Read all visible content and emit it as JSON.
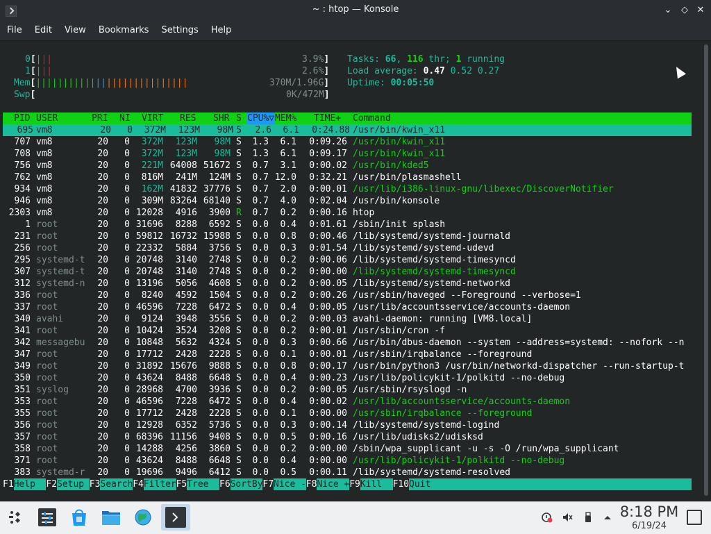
{
  "window": {
    "title": "~ : htop — Konsole",
    "controls": [
      "minimize-icon",
      "maximize-icon",
      "close-icon"
    ]
  },
  "menubar": [
    "File",
    "Edit",
    "View",
    "Bookmarks",
    "Settings",
    "Help"
  ],
  "meters": {
    "cpu0": {
      "label": "0",
      "value": "3.9%"
    },
    "cpu1": {
      "label": "1",
      "value": "2.6%"
    },
    "mem": {
      "label": "Mem",
      "value": "370M/1.96G"
    },
    "swp": {
      "label": "Swp",
      "value": "0K/472M"
    }
  },
  "stats": {
    "tasks_label": "Tasks: ",
    "tasks": "66",
    "thr": "116",
    "thr_label": " thr; ",
    "running": "1",
    "running_label": " running",
    "load_label": "Load average: ",
    "load1": "0.47",
    "load5": "0.52",
    "load15": "0.27",
    "uptime_label": "Uptime: ",
    "uptime": "00:05:50"
  },
  "columns": [
    "PID",
    "USER",
    "PRI",
    "NI",
    "VIRT",
    "RES",
    "SHR",
    "S",
    "CPU%▽",
    "MEM%",
    "TIME+",
    "Command"
  ],
  "processes": [
    {
      "pid": "695",
      "user": "vm8",
      "pri": "20",
      "ni": "0",
      "virt": "372M",
      "res": "123M",
      "shr": "98M",
      "s": "S",
      "cpu": "2.6",
      "mem": "6.1",
      "time": "0:24.88",
      "cmd": "/usr/bin/kwin_x11",
      "thread": false,
      "selected": true
    },
    {
      "pid": "707",
      "user": "vm8",
      "pri": "20",
      "ni": "0",
      "virt": "372M",
      "res": "123M",
      "shr": "98M",
      "s": "S",
      "cpu": "1.3",
      "mem": "6.1",
      "time": "0:09.26",
      "cmd": "/usr/bin/kwin_x11",
      "thread": true
    },
    {
      "pid": "708",
      "user": "vm8",
      "pri": "20",
      "ni": "0",
      "virt": "372M",
      "res": "123M",
      "shr": "98M",
      "s": "S",
      "cpu": "1.3",
      "mem": "6.1",
      "time": "0:09.17",
      "cmd": "/usr/bin/kwin_x11",
      "thread": true
    },
    {
      "pid": "756",
      "user": "vm8",
      "pri": "20",
      "ni": "0",
      "virt": "221M",
      "res": "64008",
      "shr": "51672",
      "s": "S",
      "cpu": "0.7",
      "mem": "3.1",
      "time": "0:00.02",
      "cmd": "/usr/bin/kded5",
      "thread": true
    },
    {
      "pid": "762",
      "user": "vm8",
      "pri": "20",
      "ni": "0",
      "virt": "816M",
      "res": "241M",
      "shr": "124M",
      "s": "S",
      "cpu": "0.7",
      "mem": "12.0",
      "time": "0:32.21",
      "cmd": "/usr/bin/plasmashell",
      "thread": false
    },
    {
      "pid": "934",
      "user": "vm8",
      "pri": "20",
      "ni": "0",
      "virt": "162M",
      "res": "41832",
      "shr": "37776",
      "s": "S",
      "cpu": "0.7",
      "mem": "2.0",
      "time": "0:00.01",
      "cmd": "/usr/lib/i386-linux-gnu/libexec/DiscoverNotifier",
      "thread": true
    },
    {
      "pid": "946",
      "user": "vm8",
      "pri": "20",
      "ni": "0",
      "virt": "309M",
      "res": "83264",
      "shr": "68140",
      "s": "S",
      "cpu": "0.7",
      "mem": "4.0",
      "time": "0:02.04",
      "cmd": "/usr/bin/konsole",
      "thread": false
    },
    {
      "pid": "2303",
      "user": "vm8",
      "pri": "20",
      "ni": "0",
      "virt": "12028",
      "res": "4916",
      "shr": "3900",
      "s": "R",
      "cpu": "0.7",
      "mem": "0.2",
      "time": "0:00.16",
      "cmd": "htop",
      "thread": false
    },
    {
      "pid": "1",
      "user": "root",
      "pri": "20",
      "ni": "0",
      "virt": "31696",
      "res": "8288",
      "shr": "6592",
      "s": "S",
      "cpu": "0.0",
      "mem": "0.4",
      "time": "0:01.61",
      "cmd": "/sbin/init splash",
      "thread": false
    },
    {
      "pid": "231",
      "user": "root",
      "pri": "20",
      "ni": "0",
      "virt": "59812",
      "res": "16732",
      "shr": "15988",
      "s": "S",
      "cpu": "0.0",
      "mem": "0.8",
      "time": "0:00.46",
      "cmd": "/lib/systemd/systemd-journald",
      "thread": false
    },
    {
      "pid": "256",
      "user": "root",
      "pri": "20",
      "ni": "0",
      "virt": "22332",
      "res": "5884",
      "shr": "3756",
      "s": "S",
      "cpu": "0.0",
      "mem": "0.3",
      "time": "0:01.54",
      "cmd": "/lib/systemd/systemd-udevd",
      "thread": false
    },
    {
      "pid": "295",
      "user": "systemd-t",
      "pri": "20",
      "ni": "0",
      "virt": "20748",
      "res": "3140",
      "shr": "2748",
      "s": "S",
      "cpu": "0.0",
      "mem": "0.2",
      "time": "0:00.06",
      "cmd": "/lib/systemd/systemd-timesyncd",
      "thread": false
    },
    {
      "pid": "307",
      "user": "systemd-t",
      "pri": "20",
      "ni": "0",
      "virt": "20748",
      "res": "3140",
      "shr": "2748",
      "s": "S",
      "cpu": "0.0",
      "mem": "0.2",
      "time": "0:00.00",
      "cmd": "/lib/systemd/systemd-timesyncd",
      "thread": true
    },
    {
      "pid": "312",
      "user": "systemd-n",
      "pri": "20",
      "ni": "0",
      "virt": "13196",
      "res": "5056",
      "shr": "4608",
      "s": "S",
      "cpu": "0.0",
      "mem": "0.2",
      "time": "0:00.05",
      "cmd": "/lib/systemd/systemd-networkd",
      "thread": false
    },
    {
      "pid": "336",
      "user": "root",
      "pri": "20",
      "ni": "0",
      "virt": "8240",
      "res": "4592",
      "shr": "1504",
      "s": "S",
      "cpu": "0.0",
      "mem": "0.2",
      "time": "0:00.26",
      "cmd": "/usr/sbin/haveged --Foreground --verbose=1",
      "thread": false
    },
    {
      "pid": "337",
      "user": "root",
      "pri": "20",
      "ni": "0",
      "virt": "46596",
      "res": "7228",
      "shr": "6472",
      "s": "S",
      "cpu": "0.0",
      "mem": "0.4",
      "time": "0:00.05",
      "cmd": "/usr/lib/accountsservice/accounts-daemon",
      "thread": false
    },
    {
      "pid": "340",
      "user": "avahi",
      "pri": "20",
      "ni": "0",
      "virt": "9124",
      "res": "3948",
      "shr": "3556",
      "s": "S",
      "cpu": "0.0",
      "mem": "0.2",
      "time": "0:00.03",
      "cmd": "avahi-daemon: running [VM8.local]",
      "thread": false
    },
    {
      "pid": "341",
      "user": "root",
      "pri": "20",
      "ni": "0",
      "virt": "10424",
      "res": "3524",
      "shr": "3208",
      "s": "S",
      "cpu": "0.0",
      "mem": "0.2",
      "time": "0:00.01",
      "cmd": "/usr/sbin/cron -f",
      "thread": false
    },
    {
      "pid": "342",
      "user": "messagebu",
      "pri": "20",
      "ni": "0",
      "virt": "10848",
      "res": "5632",
      "shr": "4324",
      "s": "S",
      "cpu": "0.0",
      "mem": "0.3",
      "time": "0:00.66",
      "cmd": "/usr/bin/dbus-daemon --system --address=systemd: --nofork --n",
      "thread": false
    },
    {
      "pid": "347",
      "user": "root",
      "pri": "20",
      "ni": "0",
      "virt": "17712",
      "res": "2428",
      "shr": "2228",
      "s": "S",
      "cpu": "0.0",
      "mem": "0.1",
      "time": "0:00.01",
      "cmd": "/usr/sbin/irqbalance --foreground",
      "thread": false
    },
    {
      "pid": "349",
      "user": "root",
      "pri": "20",
      "ni": "0",
      "virt": "31892",
      "res": "15676",
      "shr": "9888",
      "s": "S",
      "cpu": "0.0",
      "mem": "0.8",
      "time": "0:00.17",
      "cmd": "/usr/bin/python3 /usr/bin/networkd-dispatcher --run-startup-t",
      "thread": false
    },
    {
      "pid": "350",
      "user": "root",
      "pri": "20",
      "ni": "0",
      "virt": "43624",
      "res": "8488",
      "shr": "6648",
      "s": "S",
      "cpu": "0.0",
      "mem": "0.4",
      "time": "0:00.23",
      "cmd": "/usr/lib/policykit-1/polkitd --no-debug",
      "thread": false
    },
    {
      "pid": "351",
      "user": "syslog",
      "pri": "20",
      "ni": "0",
      "virt": "28968",
      "res": "4700",
      "shr": "3936",
      "s": "S",
      "cpu": "0.0",
      "mem": "0.2",
      "time": "0:00.05",
      "cmd": "/usr/sbin/rsyslogd -n",
      "thread": false
    },
    {
      "pid": "353",
      "user": "root",
      "pri": "20",
      "ni": "0",
      "virt": "46596",
      "res": "7228",
      "shr": "6472",
      "s": "S",
      "cpu": "0.0",
      "mem": "0.4",
      "time": "0:00.02",
      "cmd": "/usr/lib/accountsservice/accounts-daemon",
      "thread": true
    },
    {
      "pid": "355",
      "user": "root",
      "pri": "20",
      "ni": "0",
      "virt": "17712",
      "res": "2428",
      "shr": "2228",
      "s": "S",
      "cpu": "0.0",
      "mem": "0.1",
      "time": "0:00.00",
      "cmd": "/usr/sbin/irqbalance --foreground",
      "thread": true
    },
    {
      "pid": "356",
      "user": "root",
      "pri": "20",
      "ni": "0",
      "virt": "12928",
      "res": "6352",
      "shr": "5736",
      "s": "S",
      "cpu": "0.0",
      "mem": "0.3",
      "time": "0:00.14",
      "cmd": "/lib/systemd/systemd-logind",
      "thread": false
    },
    {
      "pid": "357",
      "user": "root",
      "pri": "20",
      "ni": "0",
      "virt": "68396",
      "res": "11156",
      "shr": "9408",
      "s": "S",
      "cpu": "0.0",
      "mem": "0.5",
      "time": "0:00.16",
      "cmd": "/usr/lib/udisks2/udisksd",
      "thread": false
    },
    {
      "pid": "358",
      "user": "root",
      "pri": "20",
      "ni": "0",
      "virt": "14288",
      "res": "4256",
      "shr": "3860",
      "s": "S",
      "cpu": "0.0",
      "mem": "0.2",
      "time": "0:00.00",
      "cmd": "/sbin/wpa_supplicant -u -s -O /run/wpa_supplicant",
      "thread": false
    },
    {
      "pid": "371",
      "user": "root",
      "pri": "20",
      "ni": "0",
      "virt": "43624",
      "res": "8488",
      "shr": "6648",
      "s": "S",
      "cpu": "0.0",
      "mem": "0.4",
      "time": "0:00.00",
      "cmd": "/usr/lib/policykit-1/polkitd --no-debug",
      "thread": true
    },
    {
      "pid": "383",
      "user": "systemd-r",
      "pri": "20",
      "ni": "0",
      "virt": "19696",
      "res": "9496",
      "shr": "6412",
      "s": "S",
      "cpu": "0.0",
      "mem": "0.5",
      "time": "0:00.11",
      "cmd": "/lib/systemd/systemd-resolved",
      "thread": false
    }
  ],
  "fkeys": [
    {
      "key": "F1",
      "label": "Help  "
    },
    {
      "key": "F2",
      "label": "Setup "
    },
    {
      "key": "F3",
      "label": "Search"
    },
    {
      "key": "F4",
      "label": "Filter"
    },
    {
      "key": "F5",
      "label": "Tree  "
    },
    {
      "key": "F6",
      "label": "SortBy"
    },
    {
      "key": "F7",
      "label": "Nice -"
    },
    {
      "key": "F8",
      "label": "Nice +"
    },
    {
      "key": "F9",
      "label": "Kill  "
    },
    {
      "key": "F10",
      "label": "Quit"
    }
  ],
  "taskbar": {
    "items": [
      "application-launcher-icon",
      "system-settings-icon",
      "discover-icon",
      "dolphin-file-manager-icon",
      "web-browser-icon",
      "konsole-icon"
    ],
    "tray": [
      "updates-icon",
      "volume-muted-icon",
      "usb-device-icon",
      "tray-expand-icon"
    ],
    "clock_time": "8:18 PM",
    "clock_date": "6/19/24"
  },
  "colors": {
    "terminal_bg": "#232627",
    "header_green": "#11d116",
    "selection_cyan": "#1abc9c",
    "sort_blue": "#1d99f3"
  }
}
